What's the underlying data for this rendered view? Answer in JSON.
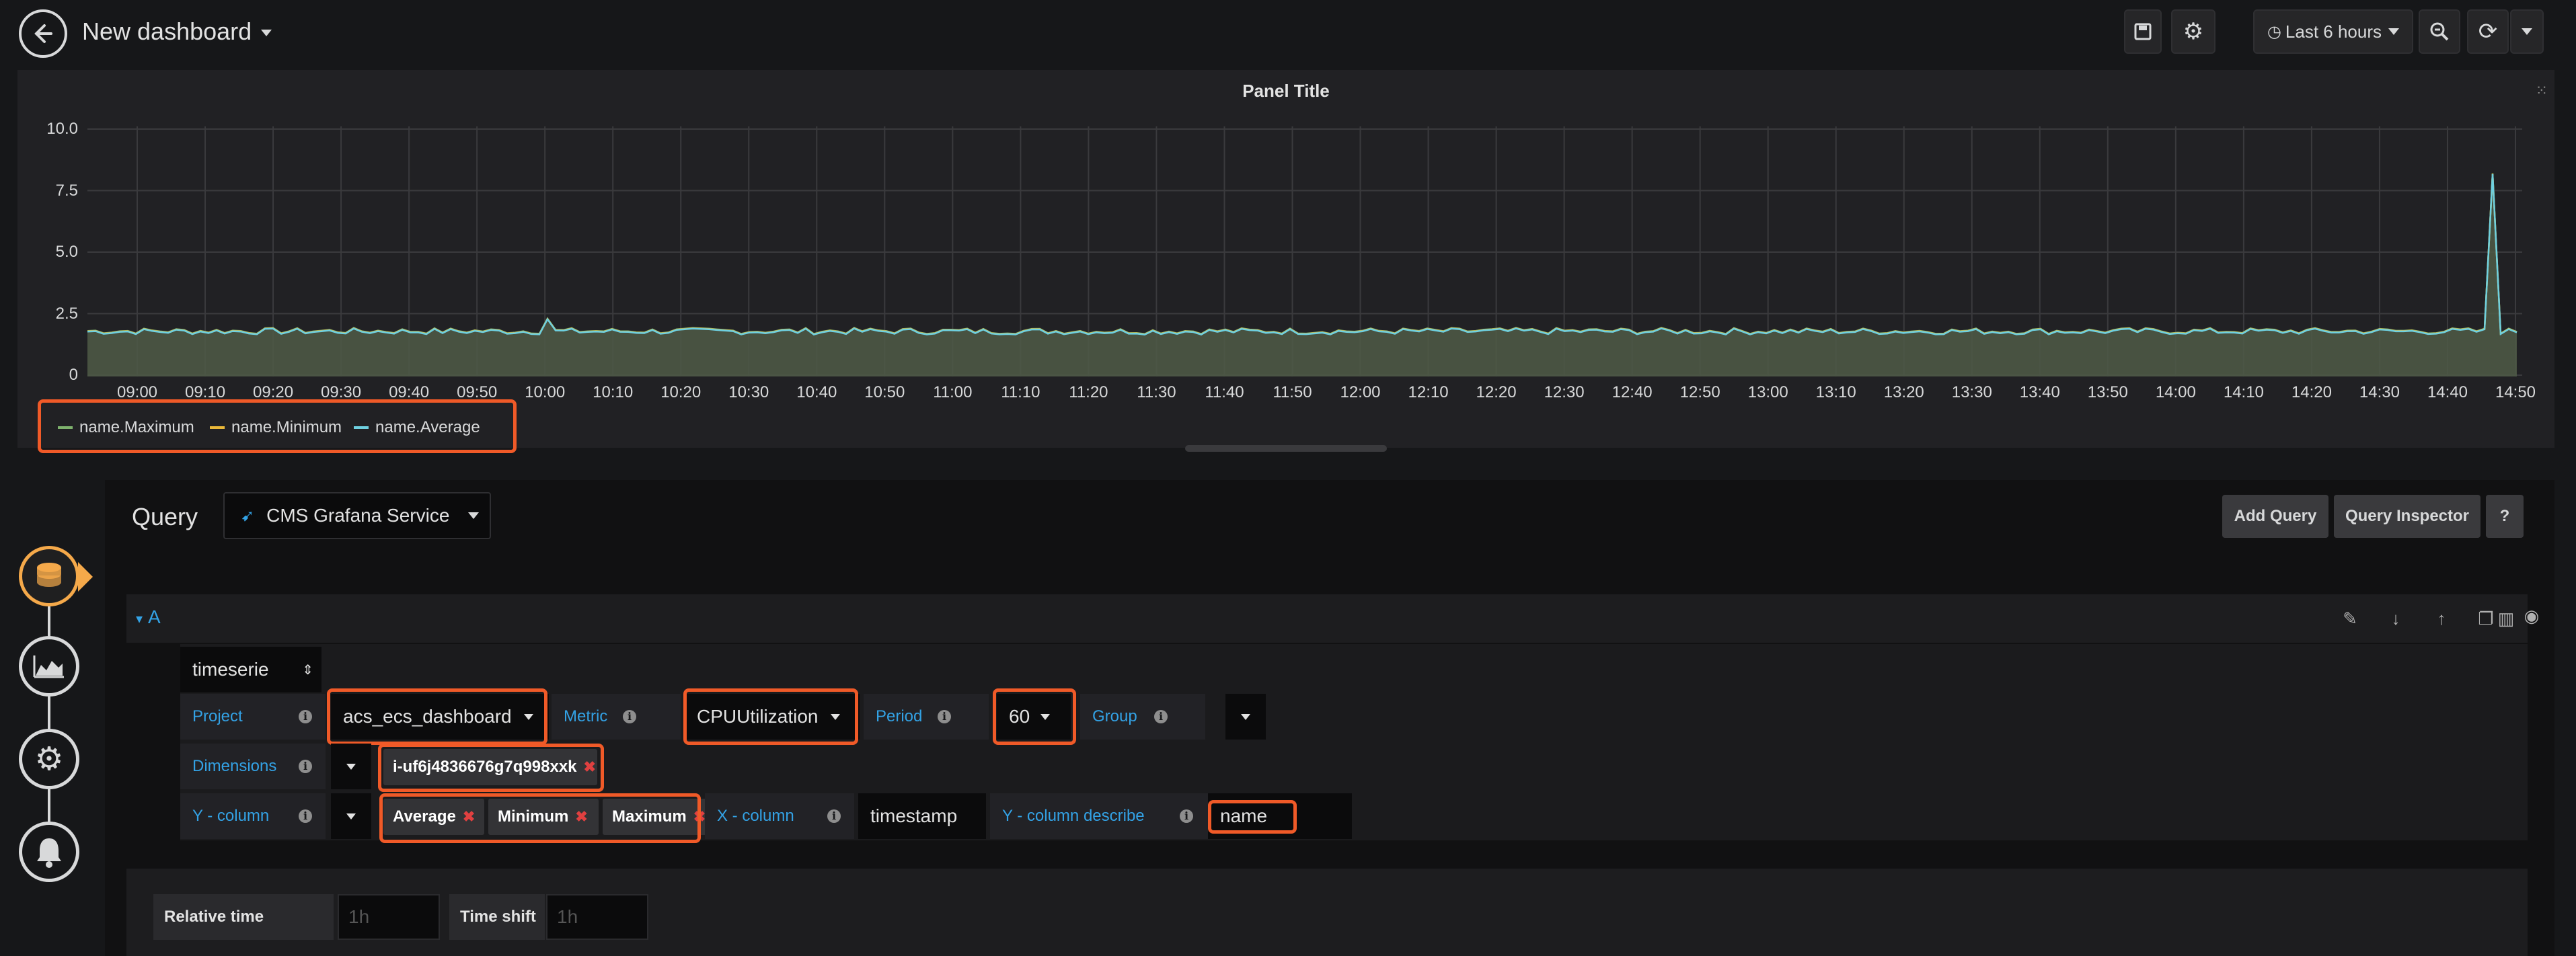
{
  "header": {
    "title": "New dashboard",
    "time_range": "Last 6 hours"
  },
  "panel": {
    "title": "Panel Title",
    "legend": [
      {
        "name": "name.Maximum",
        "color": "#7eb26d"
      },
      {
        "name": "name.Minimum",
        "color": "#eab839"
      },
      {
        "name": "name.Average",
        "color": "#6ed0e0"
      }
    ]
  },
  "chart_data": {
    "type": "area",
    "y_ticks": [
      "10.0",
      "7.5",
      "5.0",
      "2.5",
      "0"
    ],
    "ylim": [
      0,
      10
    ],
    "x_ticks": [
      "09:00",
      "09:10",
      "09:20",
      "09:30",
      "09:40",
      "09:50",
      "10:00",
      "10:10",
      "10:20",
      "10:30",
      "10:40",
      "10:50",
      "11:00",
      "11:10",
      "11:20",
      "11:30",
      "11:40",
      "11:50",
      "12:00",
      "12:10",
      "12:20",
      "12:30",
      "12:40",
      "12:50",
      "13:00",
      "13:10",
      "13:20",
      "13:30",
      "13:40",
      "13:50",
      "14:00",
      "14:10",
      "14:20",
      "14:30",
      "14:40",
      "14:50"
    ],
    "grid": true,
    "series": [
      {
        "name": "name.Maximum",
        "baseline": 1.8,
        "spikes": [
          {
            "x": "10:00",
            "y": 2.3
          },
          {
            "x": "14:47",
            "y": 8.2
          }
        ]
      },
      {
        "name": "name.Minimum",
        "baseline": 1.8
      },
      {
        "name": "name.Average",
        "baseline": 1.8
      }
    ]
  },
  "query": {
    "label": "Query",
    "datasource": "CMS Grafana Service",
    "add_query": "Add Query",
    "query_inspector": "Query Inspector",
    "help": "?",
    "row_letter": "A",
    "type_select": "timeserie",
    "project_label": "Project",
    "project_value": "acs_ecs_dashboard",
    "metric_label": "Metric",
    "metric_value": "CPUUtilization",
    "period_label": "Period",
    "period_value": "60",
    "group_label": "Group",
    "dimensions_label": "Dimensions",
    "dimension_tag": "i-uf6j4836676g7q998xxk",
    "ycol_label": "Y - column",
    "ycol_tags": [
      "Average",
      "Minimum",
      "Maximum"
    ],
    "xcol_label": "X - column",
    "xcol_value": "timestamp",
    "ydesc_label": "Y - column describe",
    "ydesc_value": "name"
  },
  "options": {
    "relative_time_label": "Relative time",
    "relative_time_placeholder": "1h",
    "time_shift_label": "Time shift",
    "time_shift_placeholder": "1h"
  },
  "colors": {
    "accent_orange": "#f05a28",
    "link_blue": "#33a2e5",
    "active_rail": "#f5a94a"
  }
}
